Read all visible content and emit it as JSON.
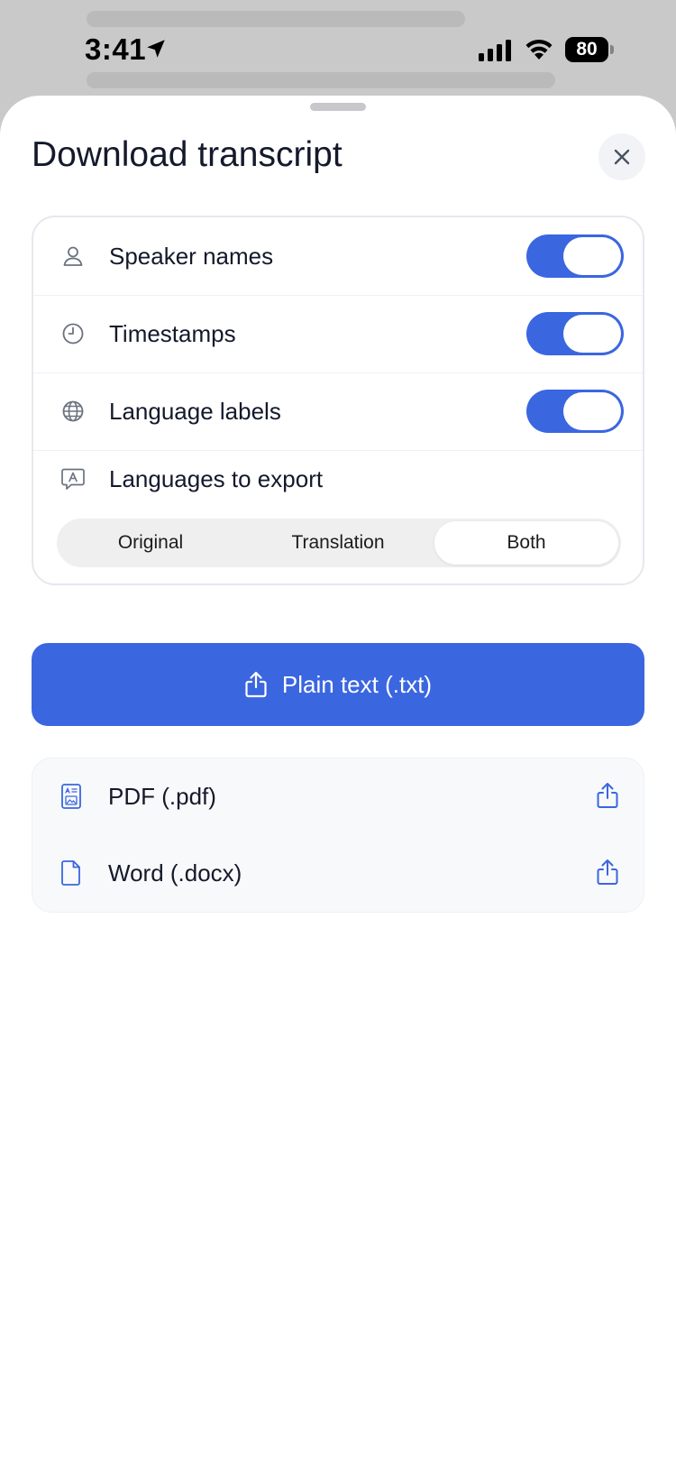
{
  "status_bar": {
    "time": "3:41",
    "battery": "80"
  },
  "sheet": {
    "title": "Download transcript"
  },
  "options": {
    "speaker_names": {
      "label": "Speaker names",
      "enabled": true
    },
    "timestamps": {
      "label": "Timestamps",
      "enabled": true
    },
    "language_labels": {
      "label": "Language labels",
      "enabled": true
    },
    "languages_to_export": {
      "label": "Languages to export",
      "segments": [
        "Original",
        "Translation",
        "Both"
      ],
      "selected": "Both"
    }
  },
  "primary_button": {
    "label": "Plain text (.txt)"
  },
  "formats": [
    {
      "label": "PDF (.pdf)",
      "icon": "pdf-document-icon"
    },
    {
      "label": "Word (.docx)",
      "icon": "document-icon"
    }
  ],
  "colors": {
    "accent": "#3a66e0",
    "icon_gray": "#6b7280",
    "text": "#14192b"
  }
}
